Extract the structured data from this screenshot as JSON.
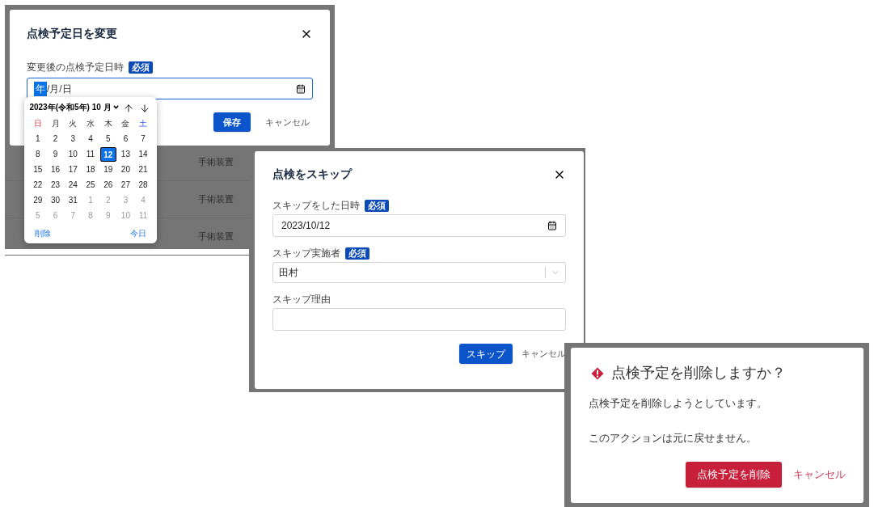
{
  "change_dialog": {
    "background_rows": [
      {
        "cell": "手術装置"
      },
      {
        "cell": "手術装置"
      },
      {
        "cell": "手術装置"
      }
    ],
    "title": "点検予定日を変更",
    "label": "変更後の点検予定日時",
    "required_badge": "必須",
    "date_parts": [
      {
        "text": "年",
        "selected": true
      },
      {
        "text": "/",
        "selected": false
      },
      {
        "text": "月",
        "selected": false
      },
      {
        "text": "/",
        "selected": false
      },
      {
        "text": "日",
        "selected": false
      }
    ],
    "save": "保存",
    "cancel": "キャンセル",
    "calendar": {
      "month": "2023年(令和5年) 10 月",
      "weekdays": [
        {
          "text": "日",
          "kind": "sunday"
        },
        {
          "text": "月",
          "kind": "weekday"
        },
        {
          "text": "火",
          "kind": "weekday"
        },
        {
          "text": "水",
          "kind": "weekday"
        },
        {
          "text": "木",
          "kind": "weekday"
        },
        {
          "text": "金",
          "kind": "weekday"
        },
        {
          "text": "土",
          "kind": "saturday"
        }
      ],
      "weeks": [
        [
          {
            "day": "1",
            "other_month": false,
            "selected": false
          },
          {
            "day": "2",
            "other_month": false,
            "selected": false
          },
          {
            "day": "3",
            "other_month": false,
            "selected": false
          },
          {
            "day": "4",
            "other_month": false,
            "selected": false
          },
          {
            "day": "5",
            "other_month": false,
            "selected": false
          },
          {
            "day": "6",
            "other_month": false,
            "selected": false
          },
          {
            "day": "7",
            "other_month": false,
            "selected": false
          }
        ],
        [
          {
            "day": "8",
            "other_month": false,
            "selected": false
          },
          {
            "day": "9",
            "other_month": false,
            "selected": false
          },
          {
            "day": "10",
            "other_month": false,
            "selected": false
          },
          {
            "day": "11",
            "other_month": false,
            "selected": false
          },
          {
            "day": "12",
            "other_month": false,
            "selected": true
          },
          {
            "day": "13",
            "other_month": false,
            "selected": false
          },
          {
            "day": "14",
            "other_month": false,
            "selected": false
          }
        ],
        [
          {
            "day": "15",
            "other_month": false,
            "selected": false
          },
          {
            "day": "16",
            "other_month": false,
            "selected": false
          },
          {
            "day": "17",
            "other_month": false,
            "selected": false
          },
          {
            "day": "18",
            "other_month": false,
            "selected": false
          },
          {
            "day": "19",
            "other_month": false,
            "selected": false
          },
          {
            "day": "20",
            "other_month": false,
            "selected": false
          },
          {
            "day": "21",
            "other_month": false,
            "selected": false
          }
        ],
        [
          {
            "day": "22",
            "other_month": false,
            "selected": false
          },
          {
            "day": "23",
            "other_month": false,
            "selected": false
          },
          {
            "day": "24",
            "other_month": false,
            "selected": false
          },
          {
            "day": "25",
            "other_month": false,
            "selected": false
          },
          {
            "day": "26",
            "other_month": false,
            "selected": false
          },
          {
            "day": "27",
            "other_month": false,
            "selected": false
          },
          {
            "day": "28",
            "other_month": false,
            "selected": false
          }
        ],
        [
          {
            "day": "29",
            "other_month": false,
            "selected": false
          },
          {
            "day": "30",
            "other_month": false,
            "selected": false
          },
          {
            "day": "31",
            "other_month": false,
            "selected": false
          },
          {
            "day": "1",
            "other_month": true,
            "selected": false
          },
          {
            "day": "2",
            "other_month": true,
            "selected": false
          },
          {
            "day": "3",
            "other_month": true,
            "selected": false
          },
          {
            "day": "4",
            "other_month": true,
            "selected": false
          }
        ],
        [
          {
            "day": "5",
            "other_month": true,
            "selected": false
          },
          {
            "day": "6",
            "other_month": true,
            "selected": false
          },
          {
            "day": "7",
            "other_month": true,
            "selected": false
          },
          {
            "day": "8",
            "other_month": true,
            "selected": false
          },
          {
            "day": "9",
            "other_month": true,
            "selected": false
          },
          {
            "day": "10",
            "other_month": true,
            "selected": false
          },
          {
            "day": "11",
            "other_month": true,
            "selected": false
          }
        ]
      ],
      "clear": "削除",
      "today": "今日"
    }
  },
  "skip_dialog": {
    "title": "点検をスキップ",
    "fields": [
      {
        "kind": "date",
        "label": "スキップをした日時",
        "required": true,
        "required_badge": "必須",
        "value": "2023/10/12"
      },
      {
        "kind": "select",
        "label": "スキップ実施者",
        "required": true,
        "required_badge": "必須",
        "value": "田村"
      },
      {
        "kind": "text",
        "label": "スキップ理由",
        "required": false
      }
    ],
    "submit": "スキップ",
    "cancel": "キャンセル"
  },
  "delete_dialog": {
    "title": "点検予定を削除しますか？",
    "paragraphs": [
      "点検予定を削除しようとしています。",
      "このアクションは元に戻せません。"
    ],
    "confirm": "点検予定を削除",
    "cancel": "キャンセル"
  }
}
